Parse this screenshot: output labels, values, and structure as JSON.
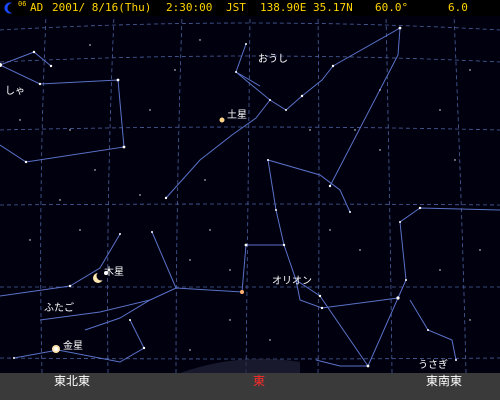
{
  "status": {
    "moon_age": "06",
    "era": "AD",
    "date": "2001/ 8/16(Thu)",
    "time": "2:30:00",
    "timezone": "JST",
    "coords": "138.90E 35.17N",
    "altitude": "60.0°",
    "magnitude": "6.0",
    "text_color": "#ffd400"
  },
  "sky": {
    "background": "#00000f",
    "grid_color": "#5a72b8",
    "line_color": "#5a72c8"
  },
  "constellations": {
    "auriga": "おうし",
    "gemini_left": "しゃ",
    "gemini": "ふたご",
    "orion": "オリオン",
    "lepus": "うさぎ"
  },
  "planets": {
    "saturn": "土星",
    "jupiter": "木星",
    "venus": "金星"
  },
  "compass": {
    "ene": "東北東",
    "e": "東",
    "ese": "東南東",
    "east_color": "#ff2a2a"
  }
}
